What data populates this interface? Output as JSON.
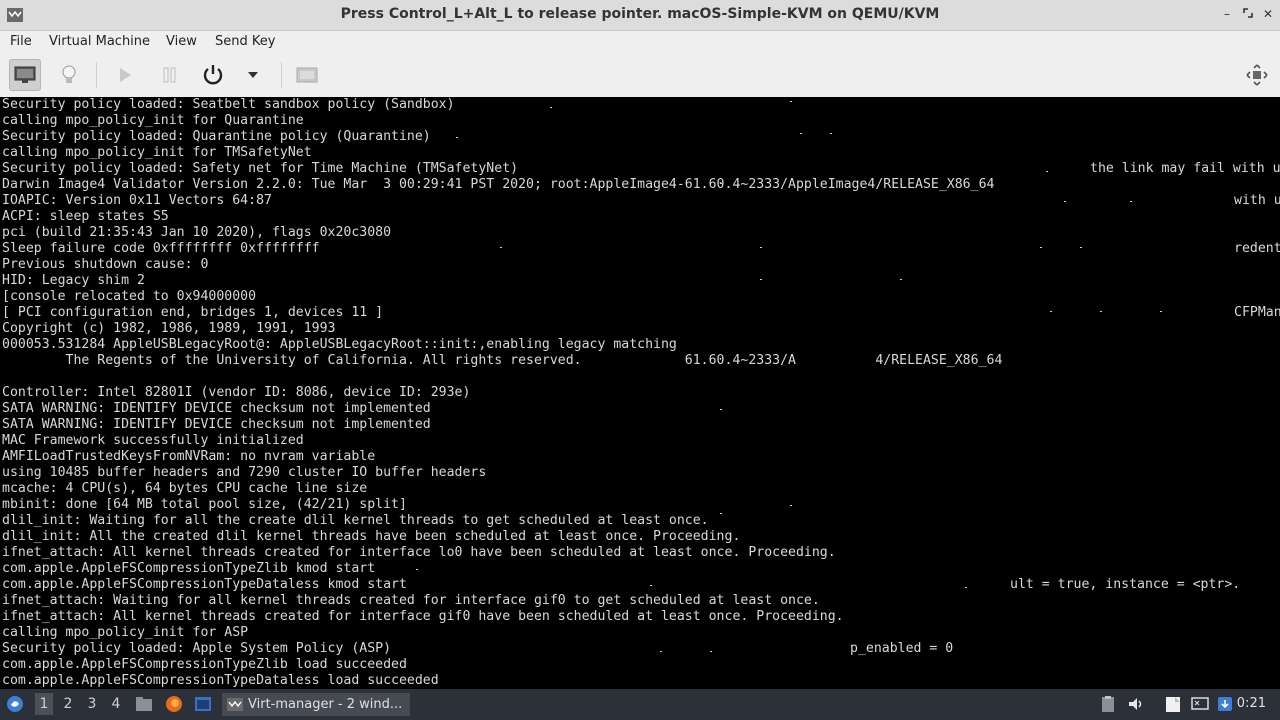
{
  "window": {
    "title": "Press Control_L+Alt_L to release pointer. macOS-Simple-KVM on QEMU/KVM"
  },
  "menu": [
    "File",
    "Virtual Machine",
    "View",
    "Send Key"
  ],
  "toolbar": {
    "icons": [
      "monitor-icon",
      "bulb-icon",
      "play-icon",
      "pause-icon",
      "power-icon",
      "dropdown-arrow-icon",
      "screenshot-icon",
      "fullscreen-icon"
    ]
  },
  "console": {
    "lines": [
      "Security policy loaded: Seatbelt sandbox policy (Sandbox)",
      "calling mpo_policy_init for Quarantine",
      "Security policy loaded: Quarantine policy (Quarantine)",
      "calling mpo_policy_init for TMSafetyNet",
      "Security policy loaded: Safety net for Time Machine (TMSafetyNet)",
      "Darwin Image4 Validator Version 2.2.0: Tue Mar  3 00:29:41 PST 2020; root:AppleImage4-61.60.4~2333/AppleImage4/RELEASE_X86_64",
      "IOAPIC: Version 0x11 Vectors 64:87",
      "ACPI: sleep states S5",
      "pci (build 21:35:43 Jan 10 2020), flags 0x20c3080",
      "Sleep failure code 0xffffffff 0xffffffff",
      "Previous shutdown cause: 0",
      "HID: Legacy shim 2",
      "[console relocated to 0x94000000",
      "[ PCI configuration end, bridges 1, devices 11 ]",
      "Copyright (c) 1982, 1986, 1989, 1991, 1993",
      "000053.531284 AppleUSBLegacyRoot@: AppleUSBLegacyRoot::init:,enabling legacy matching",
      "        The Regents of the University of California. All rights reserved.             61.60.4~2333/A          4/RELEASE_X86_64",
      "",
      "Controller: Intel 82801I (vendor ID: 8086, device ID: 293e)",
      "SATA WARNING: IDENTIFY DEVICE checksum not implemented",
      "SATA WARNING: IDENTIFY DEVICE checksum not implemented",
      "MAC Framework successfully initialized",
      "AMFILoadTrustedKeysFromNVRam: no nvram variable",
      "using 10485 buffer headers and 7290 cluster IO buffer headers",
      "mcache: 4 CPU(s), 64 bytes CPU cache line size",
      "mbinit: done [64 MB total pool size, (42/21) split]",
      "dlil_init: Waiting for all the create dlil kernel threads to get scheduled at least once.",
      "dlil_init: All the created dlil kernel threads have been scheduled at least once. Proceeding.",
      "ifnet_attach: All kernel threads created for interface lo0 have been scheduled at least once. Proceeding.",
      "com.apple.AppleFSCompressionTypeZlib kmod start",
      "com.apple.AppleFSCompressionTypeDataless kmod start",
      "ifnet_attach: Waiting for all kernel threads created for interface gif0 to get scheduled at least once.",
      "ifnet_attach: All kernel threads created for interface gif0 have been scheduled at least once. Proceeding.",
      "calling mpo_policy_init for ASP",
      "Security policy loaded: Apple System Policy (ASP)",
      "com.apple.AppleFSCompressionTypeZlib load succeeded",
      "com.apple.AppleFSCompressionTypeDataless load succeeded"
    ],
    "fragments": [
      "the link may fail with u",
      "with u",
      "redent",
      "CFPMan",
      "ult = true, instance = <ptr>.",
      "p_enabled = 0"
    ]
  },
  "taskbar": {
    "workspaces": [
      "1",
      "2",
      "3",
      "4"
    ],
    "task_label": "Virt-manager - 2 wind...",
    "clock": "0:21"
  }
}
